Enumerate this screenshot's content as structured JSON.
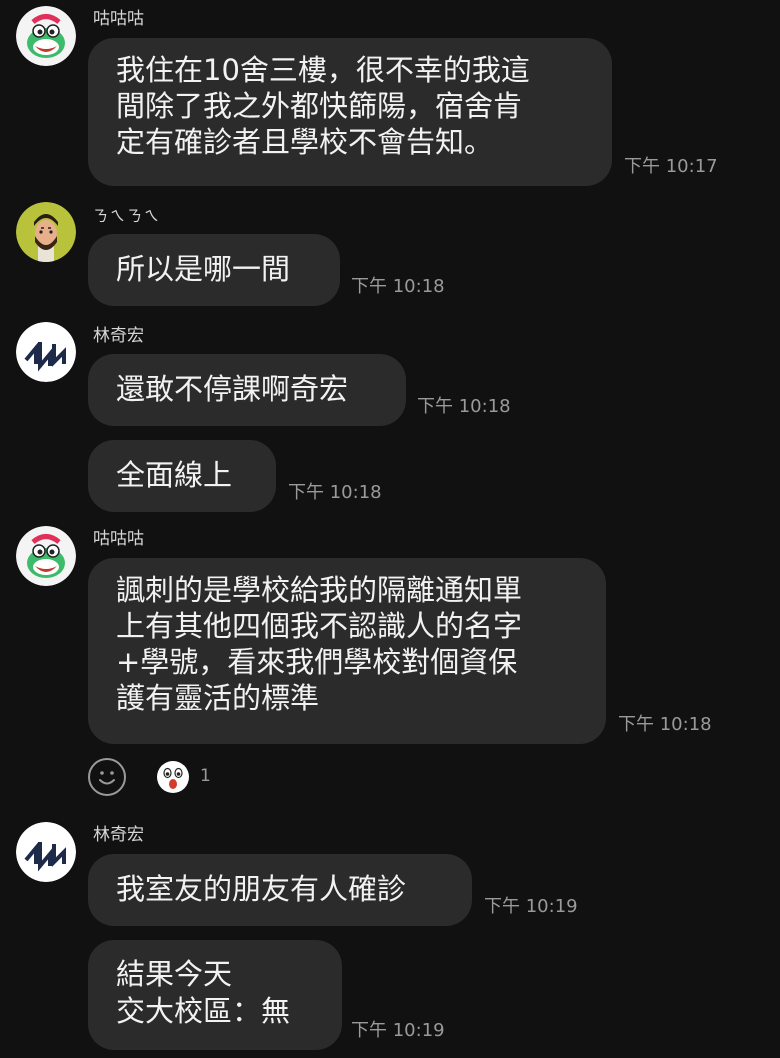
{
  "messages": [
    {
      "sender": "咕咕咕",
      "text": "我住在10舍三樓，很不幸的我這\n間除了我之外都快篩陽，宿舍肯\n定有確診者且學校不會告知。",
      "time": "下午 10:17"
    },
    {
      "sender": "ㄋㄟㄋㄟ",
      "text": "所以是哪一間",
      "time": "下午 10:18"
    },
    {
      "sender": "林奇宏",
      "text": "還敢不停課啊奇宏",
      "time": "下午 10:18"
    },
    {
      "text": "全面線上",
      "time": "下午 10:18"
    },
    {
      "sender": "咕咕咕",
      "text": "諷刺的是學校給我的隔離通知單\n上有其他四個我不認識人的名字\n+學號，看來我們學校對個資保\n護有靈活的標準",
      "time": "下午 10:18"
    },
    {
      "sender": "林奇宏",
      "text": "我室友的朋友有人確診",
      "time": "下午 10:19"
    },
    {
      "text": "結果今天\n交大校區：無",
      "time": "下午 10:19"
    }
  ],
  "reactions": {
    "add_icon": "smiley-icon",
    "sticker_icon": "surprised-face-icon",
    "count": "1"
  },
  "colors": {
    "background": "#111111",
    "bubble": "#2b2b2b",
    "text": "#f2f2f2",
    "meta": "#9a9a9a"
  }
}
